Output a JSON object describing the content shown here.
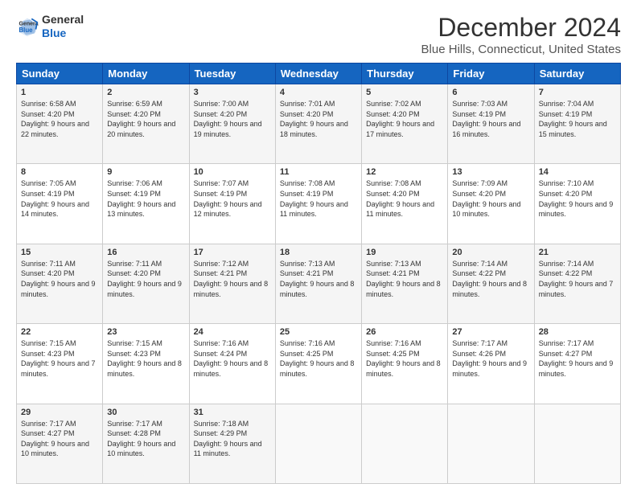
{
  "header": {
    "logo_line1": "General",
    "logo_line2": "Blue",
    "title": "December 2024",
    "subtitle": "Blue Hills, Connecticut, United States"
  },
  "columns": [
    "Sunday",
    "Monday",
    "Tuesday",
    "Wednesday",
    "Thursday",
    "Friday",
    "Saturday"
  ],
  "weeks": [
    [
      {
        "day": "1",
        "sunrise": "6:58 AM",
        "sunset": "4:20 PM",
        "daylight": "9 hours and 22 minutes."
      },
      {
        "day": "2",
        "sunrise": "6:59 AM",
        "sunset": "4:20 PM",
        "daylight": "9 hours and 20 minutes."
      },
      {
        "day": "3",
        "sunrise": "7:00 AM",
        "sunset": "4:20 PM",
        "daylight": "9 hours and 19 minutes."
      },
      {
        "day": "4",
        "sunrise": "7:01 AM",
        "sunset": "4:20 PM",
        "daylight": "9 hours and 18 minutes."
      },
      {
        "day": "5",
        "sunrise": "7:02 AM",
        "sunset": "4:20 PM",
        "daylight": "9 hours and 17 minutes."
      },
      {
        "day": "6",
        "sunrise": "7:03 AM",
        "sunset": "4:19 PM",
        "daylight": "9 hours and 16 minutes."
      },
      {
        "day": "7",
        "sunrise": "7:04 AM",
        "sunset": "4:19 PM",
        "daylight": "9 hours and 15 minutes."
      }
    ],
    [
      {
        "day": "8",
        "sunrise": "7:05 AM",
        "sunset": "4:19 PM",
        "daylight": "9 hours and 14 minutes."
      },
      {
        "day": "9",
        "sunrise": "7:06 AM",
        "sunset": "4:19 PM",
        "daylight": "9 hours and 13 minutes."
      },
      {
        "day": "10",
        "sunrise": "7:07 AM",
        "sunset": "4:19 PM",
        "daylight": "9 hours and 12 minutes."
      },
      {
        "day": "11",
        "sunrise": "7:08 AM",
        "sunset": "4:19 PM",
        "daylight": "9 hours and 11 minutes."
      },
      {
        "day": "12",
        "sunrise": "7:08 AM",
        "sunset": "4:20 PM",
        "daylight": "9 hours and 11 minutes."
      },
      {
        "day": "13",
        "sunrise": "7:09 AM",
        "sunset": "4:20 PM",
        "daylight": "9 hours and 10 minutes."
      },
      {
        "day": "14",
        "sunrise": "7:10 AM",
        "sunset": "4:20 PM",
        "daylight": "9 hours and 9 minutes."
      }
    ],
    [
      {
        "day": "15",
        "sunrise": "7:11 AM",
        "sunset": "4:20 PM",
        "daylight": "9 hours and 9 minutes."
      },
      {
        "day": "16",
        "sunrise": "7:11 AM",
        "sunset": "4:20 PM",
        "daylight": "9 hours and 9 minutes."
      },
      {
        "day": "17",
        "sunrise": "7:12 AM",
        "sunset": "4:21 PM",
        "daylight": "9 hours and 8 minutes."
      },
      {
        "day": "18",
        "sunrise": "7:13 AM",
        "sunset": "4:21 PM",
        "daylight": "9 hours and 8 minutes."
      },
      {
        "day": "19",
        "sunrise": "7:13 AM",
        "sunset": "4:21 PM",
        "daylight": "9 hours and 8 minutes."
      },
      {
        "day": "20",
        "sunrise": "7:14 AM",
        "sunset": "4:22 PM",
        "daylight": "9 hours and 8 minutes."
      },
      {
        "day": "21",
        "sunrise": "7:14 AM",
        "sunset": "4:22 PM",
        "daylight": "9 hours and 7 minutes."
      }
    ],
    [
      {
        "day": "22",
        "sunrise": "7:15 AM",
        "sunset": "4:23 PM",
        "daylight": "9 hours and 7 minutes."
      },
      {
        "day": "23",
        "sunrise": "7:15 AM",
        "sunset": "4:23 PM",
        "daylight": "9 hours and 8 minutes."
      },
      {
        "day": "24",
        "sunrise": "7:16 AM",
        "sunset": "4:24 PM",
        "daylight": "9 hours and 8 minutes."
      },
      {
        "day": "25",
        "sunrise": "7:16 AM",
        "sunset": "4:25 PM",
        "daylight": "9 hours and 8 minutes."
      },
      {
        "day": "26",
        "sunrise": "7:16 AM",
        "sunset": "4:25 PM",
        "daylight": "9 hours and 8 minutes."
      },
      {
        "day": "27",
        "sunrise": "7:17 AM",
        "sunset": "4:26 PM",
        "daylight": "9 hours and 9 minutes."
      },
      {
        "day": "28",
        "sunrise": "7:17 AM",
        "sunset": "4:27 PM",
        "daylight": "9 hours and 9 minutes."
      }
    ],
    [
      {
        "day": "29",
        "sunrise": "7:17 AM",
        "sunset": "4:27 PM",
        "daylight": "9 hours and 10 minutes."
      },
      {
        "day": "30",
        "sunrise": "7:17 AM",
        "sunset": "4:28 PM",
        "daylight": "9 hours and 10 minutes."
      },
      {
        "day": "31",
        "sunrise": "7:18 AM",
        "sunset": "4:29 PM",
        "daylight": "9 hours and 11 minutes."
      },
      null,
      null,
      null,
      null
    ]
  ]
}
